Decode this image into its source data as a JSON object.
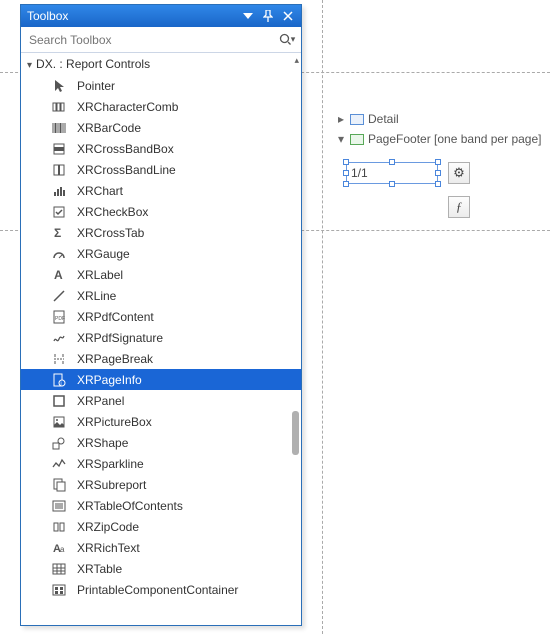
{
  "toolbox": {
    "title": "Toolbox",
    "search_placeholder": "Search Toolbox",
    "category_label": "DX.     : Report Controls",
    "items": [
      {
        "id": "pointer",
        "label": "Pointer"
      },
      {
        "id": "charcomb",
        "label": "XRCharacterComb"
      },
      {
        "id": "barcode",
        "label": "XRBarCode"
      },
      {
        "id": "crossbandbox",
        "label": "XRCrossBandBox"
      },
      {
        "id": "crossbandline",
        "label": "XRCrossBandLine"
      },
      {
        "id": "chart",
        "label": "XRChart"
      },
      {
        "id": "checkbox",
        "label": "XRCheckBox"
      },
      {
        "id": "crosstab",
        "label": "XRCrossTab"
      },
      {
        "id": "gauge",
        "label": "XRGauge"
      },
      {
        "id": "label",
        "label": "XRLabel"
      },
      {
        "id": "line",
        "label": "XRLine"
      },
      {
        "id": "pdfcontent",
        "label": "XRPdfContent"
      },
      {
        "id": "pdfsignature",
        "label": "XRPdfSignature"
      },
      {
        "id": "pagebreak",
        "label": "XRPageBreak"
      },
      {
        "id": "pageinfo",
        "label": "XRPageInfo",
        "selected": true
      },
      {
        "id": "panel",
        "label": "XRPanel"
      },
      {
        "id": "picturebox",
        "label": "XRPictureBox"
      },
      {
        "id": "shape",
        "label": "XRShape"
      },
      {
        "id": "sparkline",
        "label": "XRSparkline"
      },
      {
        "id": "subreport",
        "label": "XRSubreport"
      },
      {
        "id": "toc",
        "label": "XRTableOfContents"
      },
      {
        "id": "zipcode",
        "label": "XRZipCode"
      },
      {
        "id": "richtext",
        "label": "XRRichText"
      },
      {
        "id": "table",
        "label": "XRTable"
      },
      {
        "id": "printable",
        "label": "PrintableComponentContainer"
      }
    ]
  },
  "designer": {
    "bands": {
      "detail": {
        "label": "Detail"
      },
      "pagefooter": {
        "label": "PageFooter [one band per page]"
      }
    },
    "pageinfo_value": "1/1",
    "smart_tag_gear": "⚙",
    "smart_tag_f": "ƒ"
  }
}
